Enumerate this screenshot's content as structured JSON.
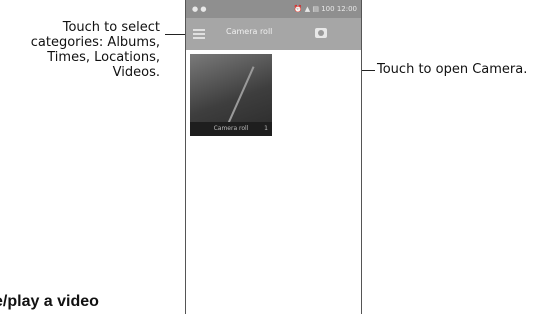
{
  "callouts": {
    "left": {
      "lines": [
        "Touch to select",
        "categories: Albums,",
        "Times, Locations,",
        "Videos."
      ]
    },
    "right": "Touch to open Camera."
  },
  "phone": {
    "status_bar": {
      "left_text": "● ●",
      "right_text": "⏰ ▲ ▤ 100 12:00"
    },
    "app_bar": {
      "menu_icon": "menu-icon",
      "title": "Camera roll",
      "camera_icon": "camera-icon"
    },
    "album": {
      "caption": "Camera roll",
      "count": "1"
    }
  },
  "page_heading": "e/play a video",
  "colors": {
    "status_bar": "#8f8f8f",
    "app_bar": "#a6a6a6",
    "caption_bar": "#1e1e1e"
  }
}
